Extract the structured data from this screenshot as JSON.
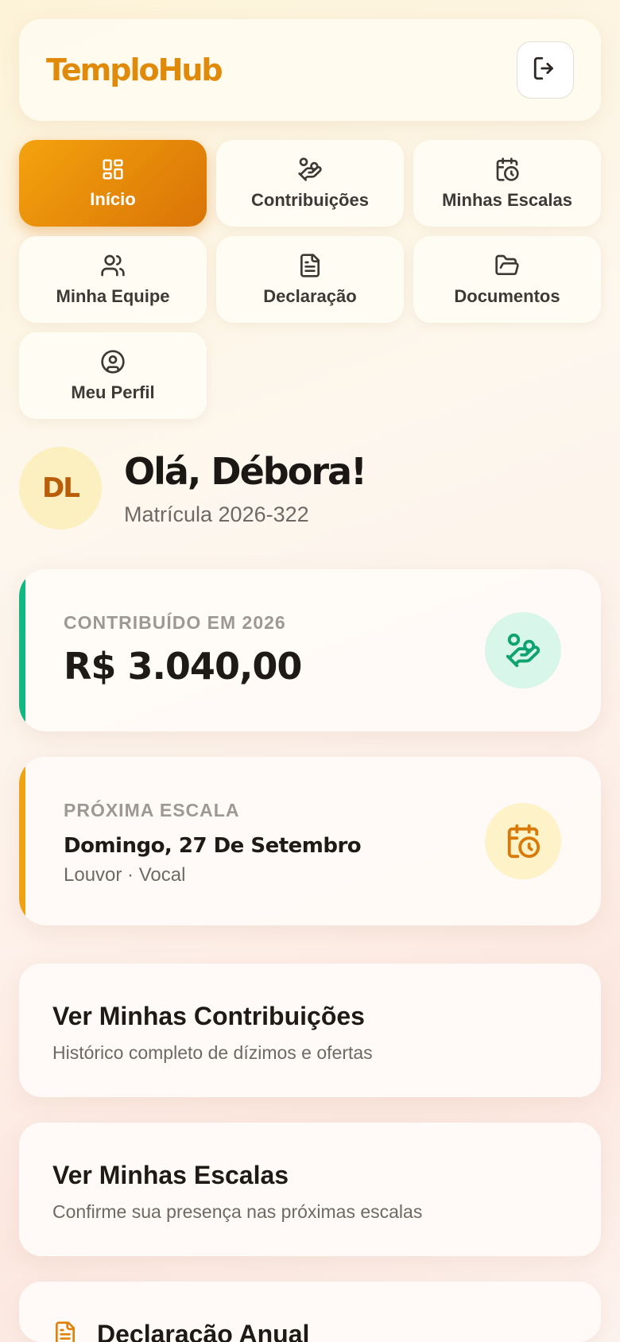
{
  "app": {
    "name": "TemploHub"
  },
  "header": {
    "logout_icon": "logout-icon"
  },
  "nav": [
    {
      "label": "Início",
      "icon": "dashboard-icon",
      "active": true
    },
    {
      "label": "Contribuições",
      "icon": "hand-coins-icon",
      "active": false
    },
    {
      "label": "Minhas Escalas",
      "icon": "calendar-clock-icon",
      "active": false
    },
    {
      "label": "Minha Equipe",
      "icon": "users-icon",
      "active": false
    },
    {
      "label": "Declaração",
      "icon": "file-text-icon",
      "active": false
    },
    {
      "label": "Documentos",
      "icon": "folder-open-icon",
      "active": false
    },
    {
      "label": "Meu Perfil",
      "icon": "user-circle-icon",
      "active": false
    }
  ],
  "user": {
    "initials": "DL",
    "greeting": "Olá, Débora!",
    "registration": "Matrícula 2026-322"
  },
  "contribution": {
    "label": "CONTRIBUÍDO EM 2026",
    "value": "R$ 3.040,00",
    "accent": "#10b981",
    "icon": "hand-coins-icon"
  },
  "next_schedule": {
    "label": "PRÓXIMA ESCALA",
    "date": "Domingo, 27 De Setembro",
    "detail": "Louvor · Vocal",
    "accent": "#f0a312",
    "icon": "calendar-clock-icon"
  },
  "links": [
    {
      "title": "Ver Minhas Contribuições",
      "subtitle": "Histórico completo de dízimos e ofertas"
    },
    {
      "title": "Ver Minhas Escalas",
      "subtitle": "Confirme sua presença nas próximas escalas"
    }
  ],
  "declaration": {
    "title": "Declaração Anual",
    "icon": "file-text-icon"
  }
}
